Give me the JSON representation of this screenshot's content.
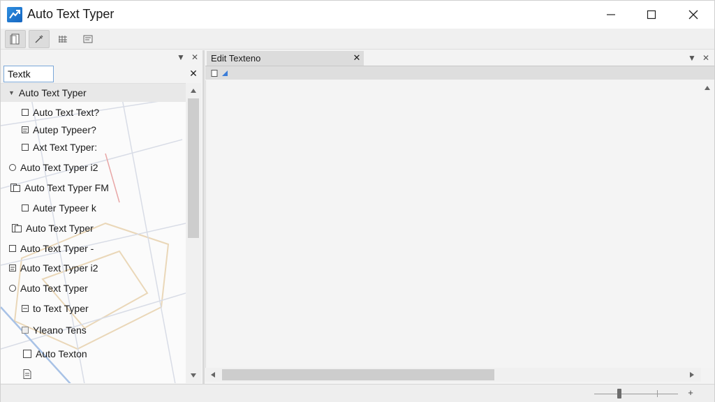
{
  "window": {
    "title": "Auto Text Typer",
    "minimize_label": "—",
    "maximize_label": "☐",
    "close_label": "✕"
  },
  "toolbar": {
    "buttons": [
      {
        "icon": "document-icon"
      },
      {
        "icon": "eyedropper-icon"
      },
      {
        "icon": "grid-icon"
      },
      {
        "icon": "list-icon"
      }
    ]
  },
  "left_panel": {
    "dropdown_label": "▼",
    "close_label": "✕",
    "search": {
      "value": "Textk",
      "clear_label": "✕"
    },
    "tree": {
      "root": {
        "label": "Auto Text Typer",
        "expanded": true
      },
      "items": [
        {
          "label": "Auto Text Text?",
          "icon": "square-icon",
          "indent": 1
        },
        {
          "label": "Autер Турeer?",
          "icon": "note-icon",
          "indent": 1
        },
        {
          "label": "Axt Text Typer:",
          "icon": "square-icon",
          "indent": 1
        },
        {
          "label": "Auto Text Typer i2",
          "icon": "circle-icon",
          "indent": 0
        },
        {
          "label": "Auto Text Typer FM",
          "icon": "copy-icon",
          "indent": 0
        },
        {
          "label": "Autеr Турeer k",
          "icon": "square-icon",
          "indent": 1
        },
        {
          "label": "Auto Text Typer",
          "icon": "copy-icon",
          "indent": 0
        },
        {
          "label": "Auto Text Typer -",
          "icon": "square-icon",
          "indent": 0
        },
        {
          "label": "Auto Text Typer i2",
          "icon": "note-icon",
          "indent": 0
        },
        {
          "label": "Auto Text Typer",
          "icon": "circle-icon",
          "indent": 0
        },
        {
          "label": "to Text Typer",
          "icon": "minus-box-icon",
          "indent": 1
        },
        {
          "label": "Yleano Tens",
          "icon": "image-icon",
          "indent": 1
        },
        {
          "label": "Auto Texton",
          "icon": "square-icon",
          "indent": 1
        },
        {
          "label": "",
          "icon": "file-icon",
          "indent": 1
        }
      ]
    }
  },
  "right_panel": {
    "tab": {
      "label": "Edit Texteno",
      "close_label": "✕"
    },
    "dropdown_label": "▼",
    "close_label": "✕"
  },
  "status_bar": {
    "zoom_plus_label": "+",
    "zoom_level": 0.3
  }
}
